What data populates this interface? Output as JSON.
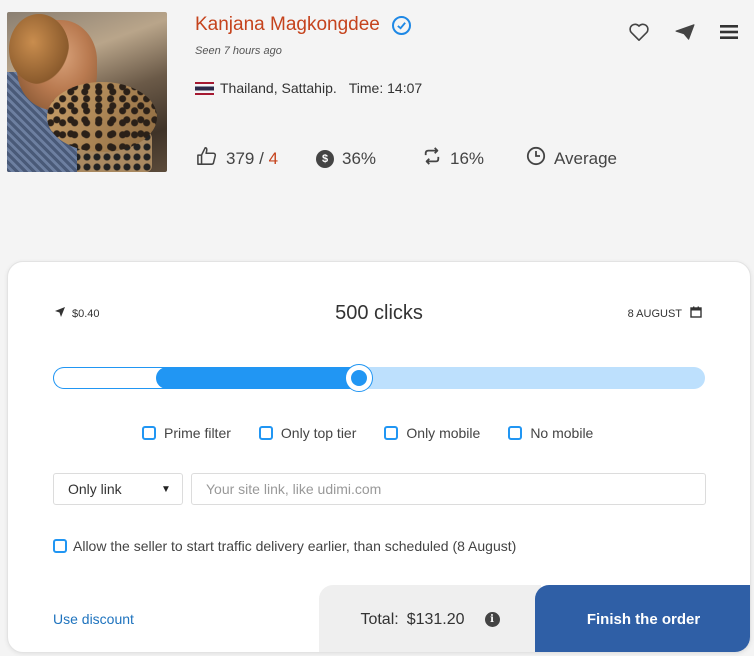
{
  "profile": {
    "name": "Kanjana Magkongdee",
    "seen": "Seen 7 hours ago",
    "location": "Thailand, Sattahip.",
    "time_label": "Time: 14:07"
  },
  "stats": {
    "likes": "379",
    "separator": "/",
    "dislikes": "4",
    "sales_percent": "36%",
    "repeat_percent": "16%",
    "speed": "Average"
  },
  "order": {
    "price": "$0.40",
    "clicks": "500 clicks",
    "date": "8 AUGUST",
    "slider_fraction": 0.47,
    "filters": [
      "Prime filter",
      "Only top tier",
      "Only mobile",
      "No mobile"
    ],
    "link_select": "Only link",
    "link_placeholder": "Your site link, like udimi.com",
    "allow_label": "Allow the seller to start traffic delivery earlier, than scheduled (8 August)",
    "discount_label": "Use discount",
    "total_label": "Total:",
    "total_value": "$131.20",
    "finish_label": "Finish the order"
  },
  "colors": {
    "name": "#c5431d",
    "accent": "#2196f3",
    "finish": "#2f5fa6",
    "link": "#1e73be"
  },
  "icons": [
    "verified-icon",
    "heart-icon",
    "send-icon",
    "menu-icon",
    "thumbs-up-icon",
    "dollar-icon",
    "repeat-icon",
    "clock-icon",
    "location-arrow-icon",
    "calendar-icon",
    "info-icon",
    "thailand-flag-icon"
  ]
}
